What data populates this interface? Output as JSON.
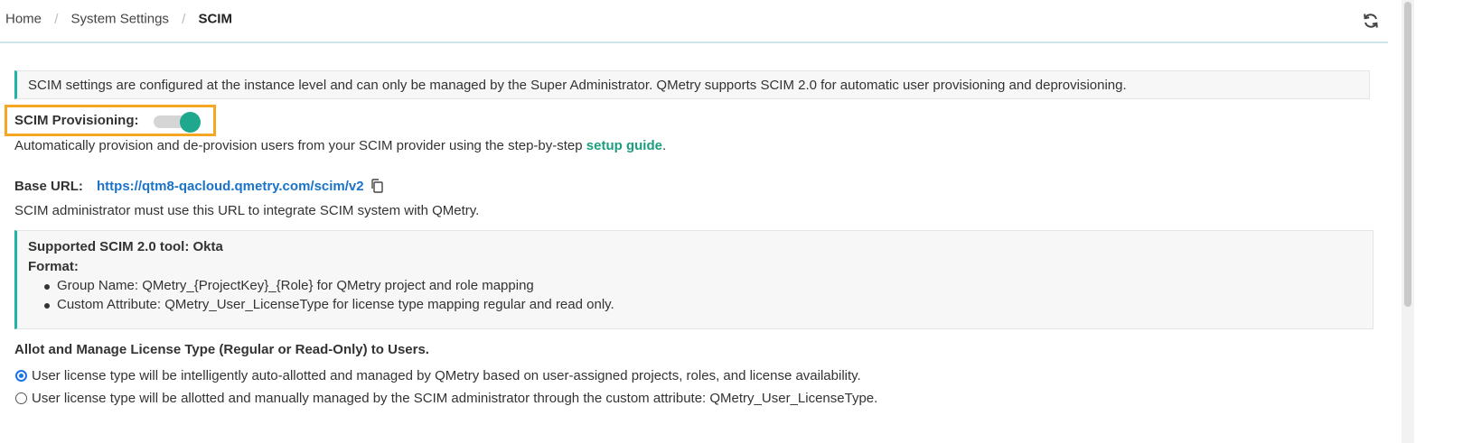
{
  "breadcrumb": {
    "home": "Home",
    "separator": "/",
    "system_settings": "System Settings",
    "current": "SCIM"
  },
  "info_note": "SCIM settings are configured at the instance level and can only be managed by the Super Administrator. QMetry supports SCIM 2.0 for automatic user provisioning and deprovisioning.",
  "provisioning": {
    "label": "SCIM Provisioning:",
    "enabled": true,
    "description_prefix": "Automatically provision and de-provision users from your SCIM provider using the step-by-step",
    "guide_link": "setup guide",
    "description_suffix": "."
  },
  "base_url": {
    "label": "Base URL:",
    "url": "https://qtm8-qacloud.qmetry.com/scim/v2",
    "note": "SCIM administrator must use this URL to integrate SCIM system with QMetry."
  },
  "supported_tool": {
    "title": "Supported SCIM 2.0 tool: Okta",
    "format_label": "Format:",
    "items": [
      "Group Name: QMetry_{ProjectKey}_{Role} for QMetry project and role mapping",
      "Custom Attribute: QMetry_User_LicenseType for license type mapping regular and read only."
    ]
  },
  "license": {
    "title": "Allot and Manage License Type (Regular or Read-Only) to Users.",
    "options": [
      {
        "label": "User license type will be intelligently auto-allotted and managed by QMetry based on user-assigned projects, roles, and license availability.",
        "checked": true
      },
      {
        "label": "User license type will be allotted and manually managed by the SCIM administrator through the custom attribute: QMetry_User_LicenseType.",
        "checked": false
      }
    ]
  },
  "colors": {
    "accent": "#1fb4a6",
    "toggle_on": "#1fa88e",
    "link": "#1a73c8",
    "highlight": "#f5a623"
  },
  "icons": [
    "refresh-icon",
    "copy-icon"
  ]
}
